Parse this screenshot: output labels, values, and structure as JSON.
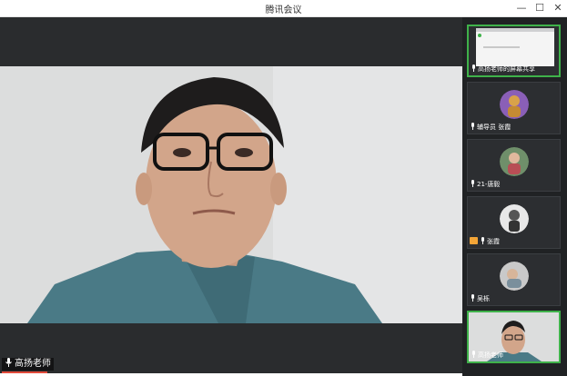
{
  "window": {
    "title": "腾讯会议",
    "min_glyph": "—",
    "max_glyph": "☐",
    "close_glyph": "✕"
  },
  "main_video": {
    "speaker_name": "高扬老师"
  },
  "participants": [
    {
      "label": "高扬老师的屏幕共享",
      "selected": true
    },
    {
      "label": "辅导员 张霞"
    },
    {
      "label": "21-唐毅"
    },
    {
      "label": "张霞"
    },
    {
      "label": "吴栎"
    },
    {
      "label": "高扬老师",
      "selected": true
    }
  ],
  "colors": {
    "accent_green": "#3fb24a",
    "active_red": "#e24a3a",
    "sidebar_bg": "#202224"
  }
}
